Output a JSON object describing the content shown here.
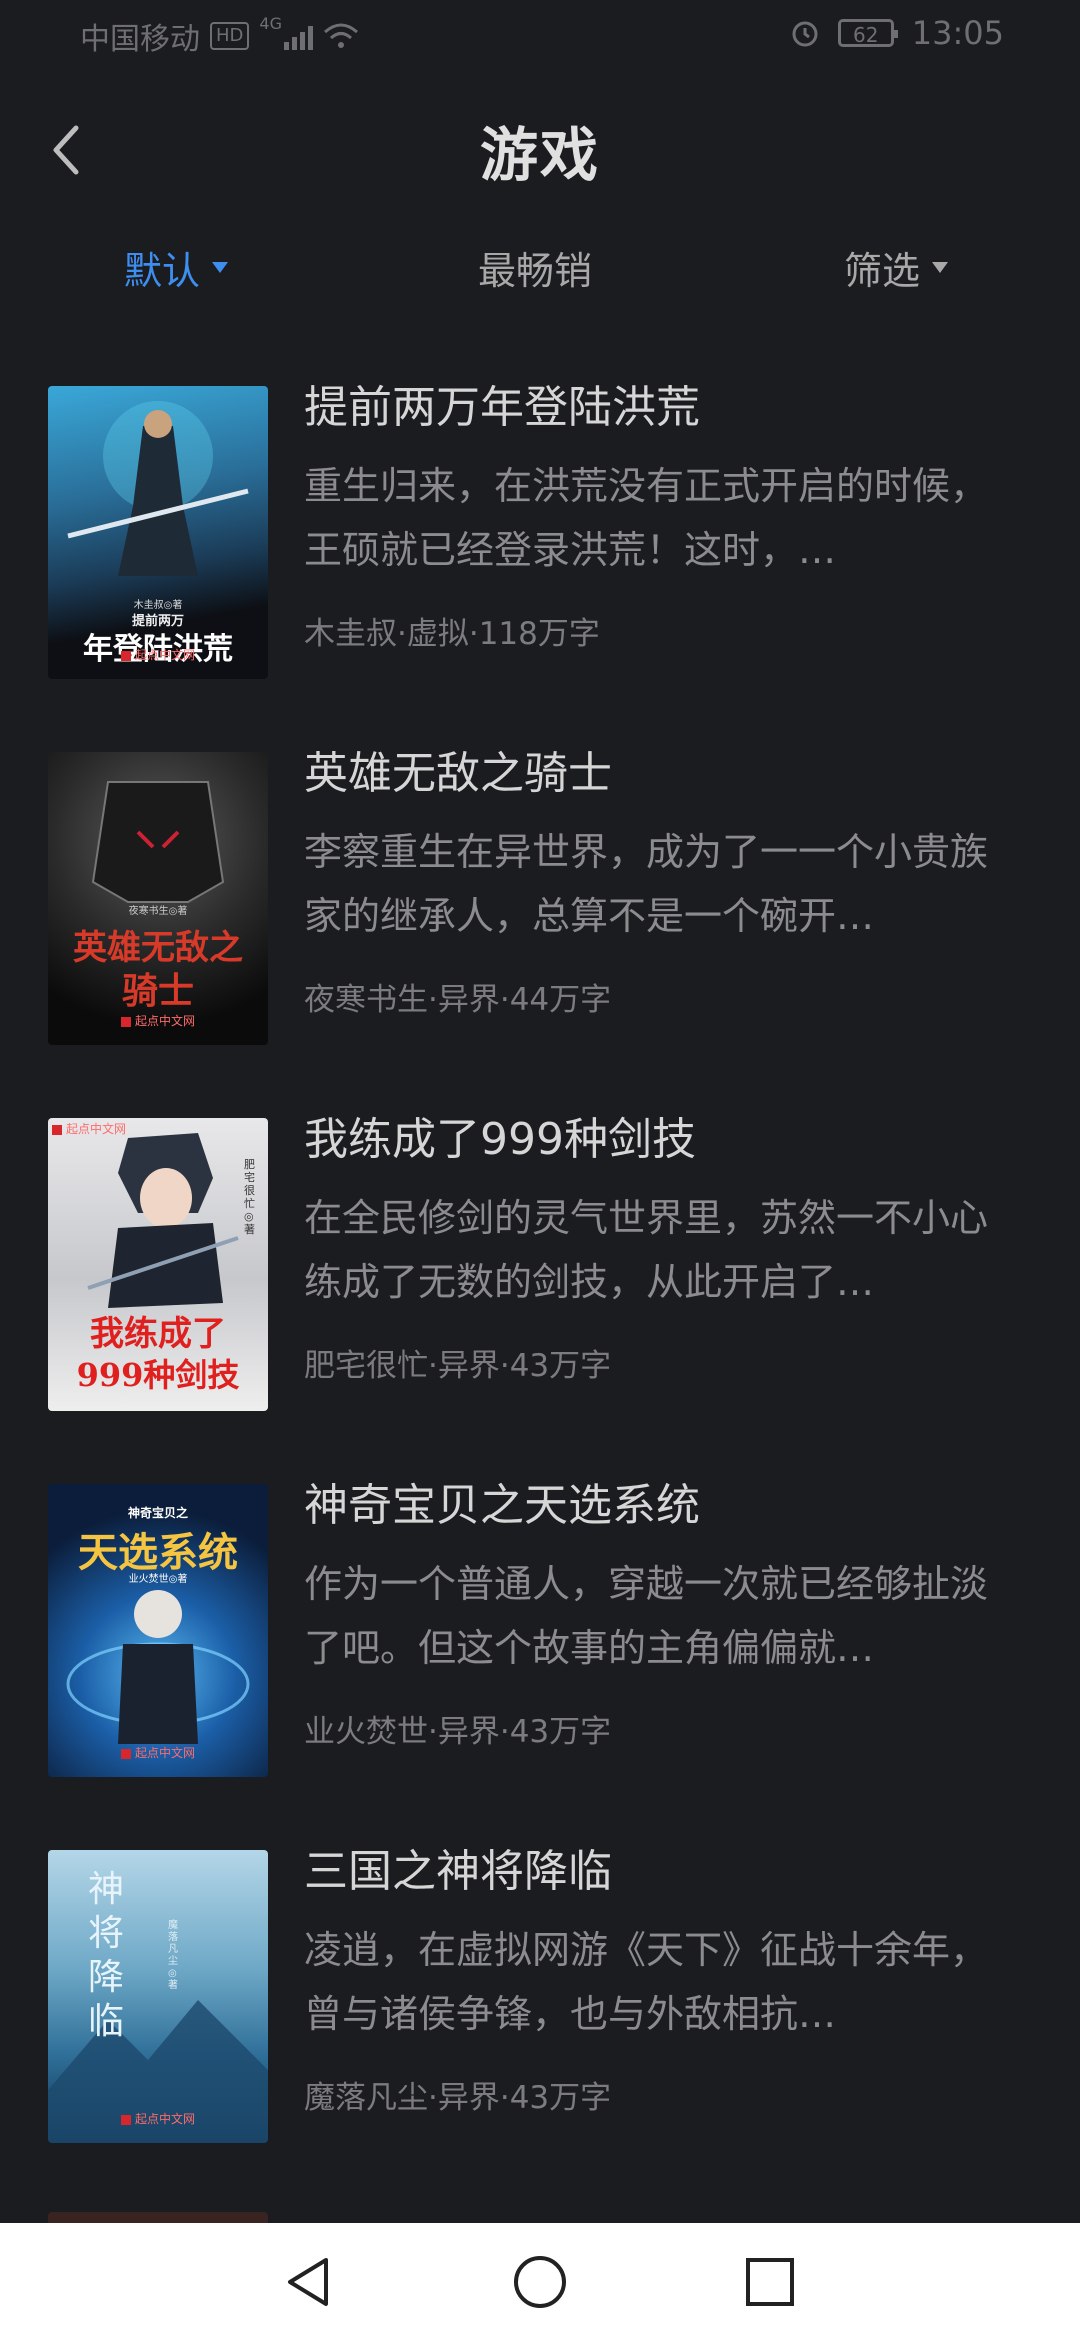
{
  "status_bar": {
    "carrier": "中国移动",
    "hd": "HD",
    "network": "4G",
    "battery": "62",
    "time": "13:05"
  },
  "header": {
    "title": "游戏"
  },
  "tabs": [
    {
      "label": "默认",
      "active": true
    },
    {
      "label": "最畅销",
      "active": false
    },
    {
      "label": "筛选",
      "active": false
    }
  ],
  "books": [
    {
      "title": "提前两万年登陆洪荒",
      "description": "重生归来，在洪荒没有正式开启的时候，王硕就已经登录洪荒！这时，…",
      "meta": "木圭叔·虚拟·118万字",
      "cover": {
        "author": "木圭叔◎著",
        "title_small": "提前两万",
        "title_large": "年登陆洪荒",
        "publisher": "起点中文网"
      }
    },
    {
      "title": "英雄无敌之骑士",
      "description": "李察重生在异世界，成为了一一个小贵族家的继承人，总算不是一个碗开…",
      "meta": "夜寒书生·异界·44万字",
      "cover": {
        "author": "夜寒书生◎著",
        "title_line1": "英雄无敌之",
        "title_line2": "骑士",
        "publisher": "起点中文网"
      }
    },
    {
      "title": "我练成了999种剑技",
      "description": "在全民修剑的灵气世界里，苏然一不小心练成了无数的剑技，从此开启了…",
      "meta": "肥宅很忙·异界·43万字",
      "cover": {
        "author": "肥宅很忙◎著",
        "title_line1": "我练成了",
        "title_line2": "999种剑技",
        "publisher": "起点中文网"
      }
    },
    {
      "title": "神奇宝贝之天选系统",
      "description": "作为一个普通人，穿越一次就已经够扯淡了吧。但这个故事的主角偏偏就…",
      "meta": "业火焚世·异界·43万字",
      "cover": {
        "series": "神奇宝贝之",
        "title": "天选系统",
        "author": "业火焚世◎著",
        "publisher": "起点中文网"
      }
    },
    {
      "title": "三国之神将降临",
      "description": "凌逍，在虚拟网游《天下》征战十余年，曾与诸侯争锋，也与外敌相抗…",
      "meta": "魔落凡尘·异界·43万字",
      "cover": {
        "title": "神将降临",
        "author": "魔落凡尘◎著",
        "publisher": "起点中文网"
      }
    }
  ],
  "colors": {
    "background": "#1b1c1f",
    "accent": "#3e8ef0",
    "nav_bar": "#ffffff"
  }
}
